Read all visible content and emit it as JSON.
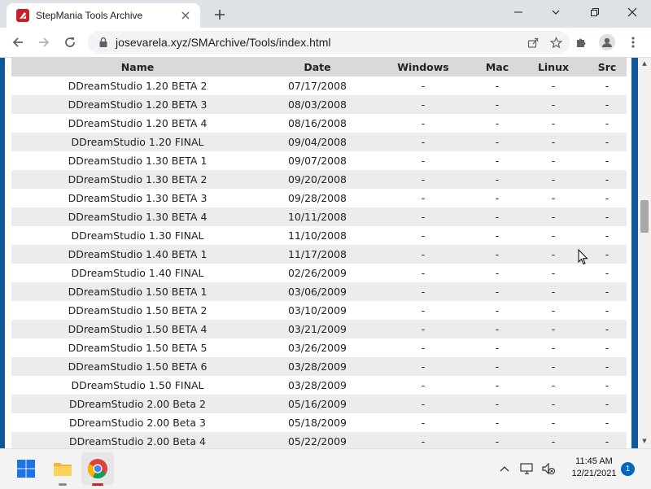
{
  "browser": {
    "tab_title": "StepMania Tools Archive",
    "url": "josevarela.xyz/SMArchive/Tools/index.html"
  },
  "table": {
    "columns": [
      "Name",
      "Date",
      "Windows",
      "Mac",
      "Linux",
      "Src"
    ],
    "rows": [
      {
        "name": "DDreamStudio 1.20 BETA 2",
        "date": "07/17/2008",
        "windows": "-",
        "mac": "-",
        "linux": "-",
        "src": "-"
      },
      {
        "name": "DDreamStudio 1.20 BETA 3",
        "date": "08/03/2008",
        "windows": "-",
        "mac": "-",
        "linux": "-",
        "src": "-"
      },
      {
        "name": "DDreamStudio 1.20 BETA 4",
        "date": "08/16/2008",
        "windows": "-",
        "mac": "-",
        "linux": "-",
        "src": "-"
      },
      {
        "name": "DDreamStudio 1.20 FINAL",
        "date": "09/04/2008",
        "windows": "-",
        "mac": "-",
        "linux": "-",
        "src": "-"
      },
      {
        "name": "DDreamStudio 1.30 BETA 1",
        "date": "09/07/2008",
        "windows": "-",
        "mac": "-",
        "linux": "-",
        "src": "-"
      },
      {
        "name": "DDreamStudio 1.30 BETA 2",
        "date": "09/20/2008",
        "windows": "-",
        "mac": "-",
        "linux": "-",
        "src": "-"
      },
      {
        "name": "DDreamStudio 1.30 BETA 3",
        "date": "09/28/2008",
        "windows": "-",
        "mac": "-",
        "linux": "-",
        "src": "-"
      },
      {
        "name": "DDreamStudio 1.30 BETA 4",
        "date": "10/11/2008",
        "windows": "-",
        "mac": "-",
        "linux": "-",
        "src": "-"
      },
      {
        "name": "DDreamStudio 1.30 FINAL",
        "date": "11/10/2008",
        "windows": "-",
        "mac": "-",
        "linux": "-",
        "src": "-"
      },
      {
        "name": "DDreamStudio 1.40 BETA 1",
        "date": "11/17/2008",
        "windows": "-",
        "mac": "-",
        "linux": "-",
        "src": "-"
      },
      {
        "name": "DDreamStudio 1.40 FINAL",
        "date": "02/26/2009",
        "windows": "-",
        "mac": "-",
        "linux": "-",
        "src": "-"
      },
      {
        "name": "DDreamStudio 1.50 BETA 1",
        "date": "03/06/2009",
        "windows": "-",
        "mac": "-",
        "linux": "-",
        "src": "-"
      },
      {
        "name": "DDreamStudio 1.50 BETA 2",
        "date": "03/10/2009",
        "windows": "-",
        "mac": "-",
        "linux": "-",
        "src": "-"
      },
      {
        "name": "DDreamStudio 1.50 BETA 4",
        "date": "03/21/2009",
        "windows": "-",
        "mac": "-",
        "linux": "-",
        "src": "-"
      },
      {
        "name": "DDreamStudio 1.50 BETA 5",
        "date": "03/26/2009",
        "windows": "-",
        "mac": "-",
        "linux": "-",
        "src": "-"
      },
      {
        "name": "DDreamStudio 1.50 BETA 6",
        "date": "03/28/2009",
        "windows": "-",
        "mac": "-",
        "linux": "-",
        "src": "-"
      },
      {
        "name": "DDreamStudio 1.50 FINAL",
        "date": "03/28/2009",
        "windows": "-",
        "mac": "-",
        "linux": "-",
        "src": "-"
      },
      {
        "name": "DDreamStudio 2.00 Beta 2",
        "date": "05/16/2009",
        "windows": "-",
        "mac": "-",
        "linux": "-",
        "src": "-"
      },
      {
        "name": "DDreamStudio 2.00 Beta 3",
        "date": "05/18/2009",
        "windows": "-",
        "mac": "-",
        "linux": "-",
        "src": "-"
      },
      {
        "name": "DDreamStudio 2.00 Beta 4",
        "date": "05/22/2009",
        "windows": "-",
        "mac": "-",
        "linux": "-",
        "src": "-"
      }
    ]
  },
  "taskbar": {
    "time": "11:45 AM",
    "date": "12/21/2021",
    "notification_count": "1"
  },
  "icons": {
    "tab_close": "close-icon",
    "new_tab": "plus-icon",
    "minimize": "minimize-icon",
    "restore": "restore-icon",
    "close_window": "close-icon",
    "back": "back-arrow-icon",
    "forward": "forward-arrow-icon",
    "reload": "reload-icon",
    "lock": "lock-icon",
    "share": "share-icon",
    "bookmark": "star-icon",
    "extensions": "puzzle-icon",
    "profile": "profile-icon",
    "menu": "kebab-menu-icon"
  },
  "colors": {
    "page_border": "#0e5799",
    "header_bg": "#d9d9d9",
    "row_alt": "#ececec",
    "favicon": "#c8202a"
  }
}
